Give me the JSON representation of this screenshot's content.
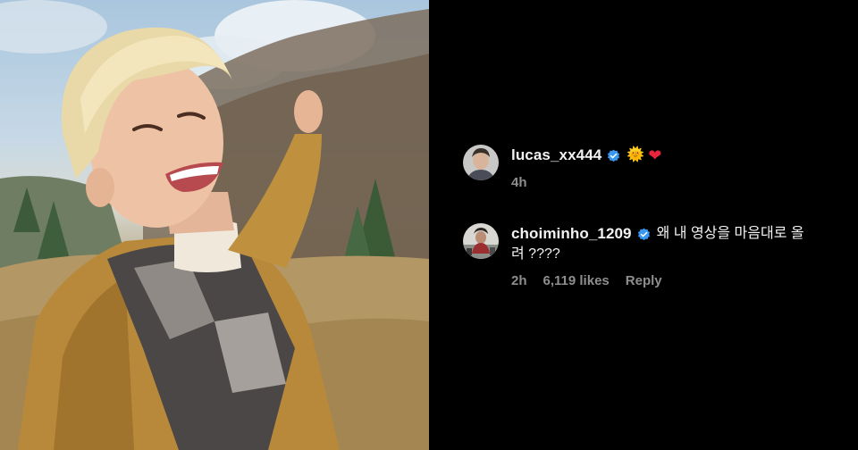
{
  "photo": {
    "alt_icon": "selfie-photo"
  },
  "comments": [
    {
      "username": "lucas_xx444",
      "verified": true,
      "text": "",
      "emojis": [
        "🌞",
        "❤"
      ],
      "time": "4h",
      "likes": "",
      "reply": ""
    },
    {
      "username": "choiminho_1209",
      "verified": true,
      "text": "왜 내 영상을 마음대로 올",
      "text_cont": "려 ????",
      "time": "2h",
      "likes": "6,119 likes",
      "reply": "Reply"
    }
  ],
  "colors": {
    "background": "#000000",
    "verified_blue": "#3897f0",
    "meta_gray": "#8e8e8e",
    "heart": "#e8253b"
  }
}
